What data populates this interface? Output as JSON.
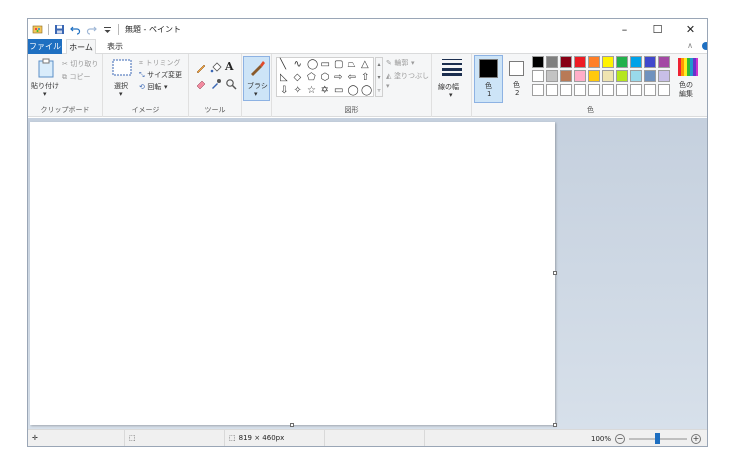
{
  "window": {
    "title": "無題 - ペイント",
    "minimize": "–",
    "maximize": "☐",
    "close": "✕"
  },
  "tabs": {
    "file": "ファイル",
    "home": "ホーム",
    "view": "表示",
    "collapse": "∧"
  },
  "clipboard": {
    "paste": "貼り付け",
    "cut": "切り取り",
    "copy": "コピー",
    "label": "クリップボード"
  },
  "image": {
    "select": "選択",
    "crop": "トリミング",
    "resize": "サイズ変更",
    "rotate": "回転",
    "label": "イメージ"
  },
  "tools": {
    "label": "ツール",
    "text_tool": "A"
  },
  "brushes": {
    "label": "ブラシ"
  },
  "shapes": {
    "outline": "輪郭",
    "fill": "塗りつぶし",
    "label": "図形",
    "glyphs": [
      [
        "╲",
        "∿",
        "◯",
        "▭",
        "▢",
        "⏢",
        "△"
      ],
      [
        "◺",
        "◇",
        "⬠",
        "⬡",
        "⇨",
        "⇦",
        "⇧"
      ],
      [
        "⇩",
        "✧",
        "☆",
        "✡",
        "▭",
        "◯",
        "◯"
      ]
    ]
  },
  "size": {
    "label": "線の幅"
  },
  "colors": {
    "color1_label": "色\n1",
    "color1_a": "色",
    "color1_b": "1",
    "color2_a": "色",
    "color2_b": "2",
    "edit_a": "色の",
    "edit_b": "編集",
    "label": "色",
    "color1": "#000000",
    "color2": "#ffffff",
    "palette_row1": [
      "#000000",
      "#7f7f7f",
      "#880015",
      "#ed1c24",
      "#ff7f27",
      "#fff200",
      "#22b14c",
      "#00a2e8",
      "#3f48cc",
      "#a349a4"
    ],
    "palette_row2": [
      "#ffffff",
      "#c3c3c3",
      "#b97a57",
      "#ffaec9",
      "#ffc90e",
      "#efe4b0",
      "#b5e61d",
      "#99d9ea",
      "#7092be",
      "#c8bfe7"
    ],
    "palette_row3": [
      "#ffffff",
      "#ffffff",
      "#ffffff",
      "#ffffff",
      "#ffffff",
      "#ffffff",
      "#ffffff",
      "#ffffff",
      "#ffffff",
      "#ffffff"
    ]
  },
  "status": {
    "canvas_size": "819 × 460px",
    "zoom": "100%",
    "zoom_minus": "−",
    "zoom_plus": "+"
  }
}
